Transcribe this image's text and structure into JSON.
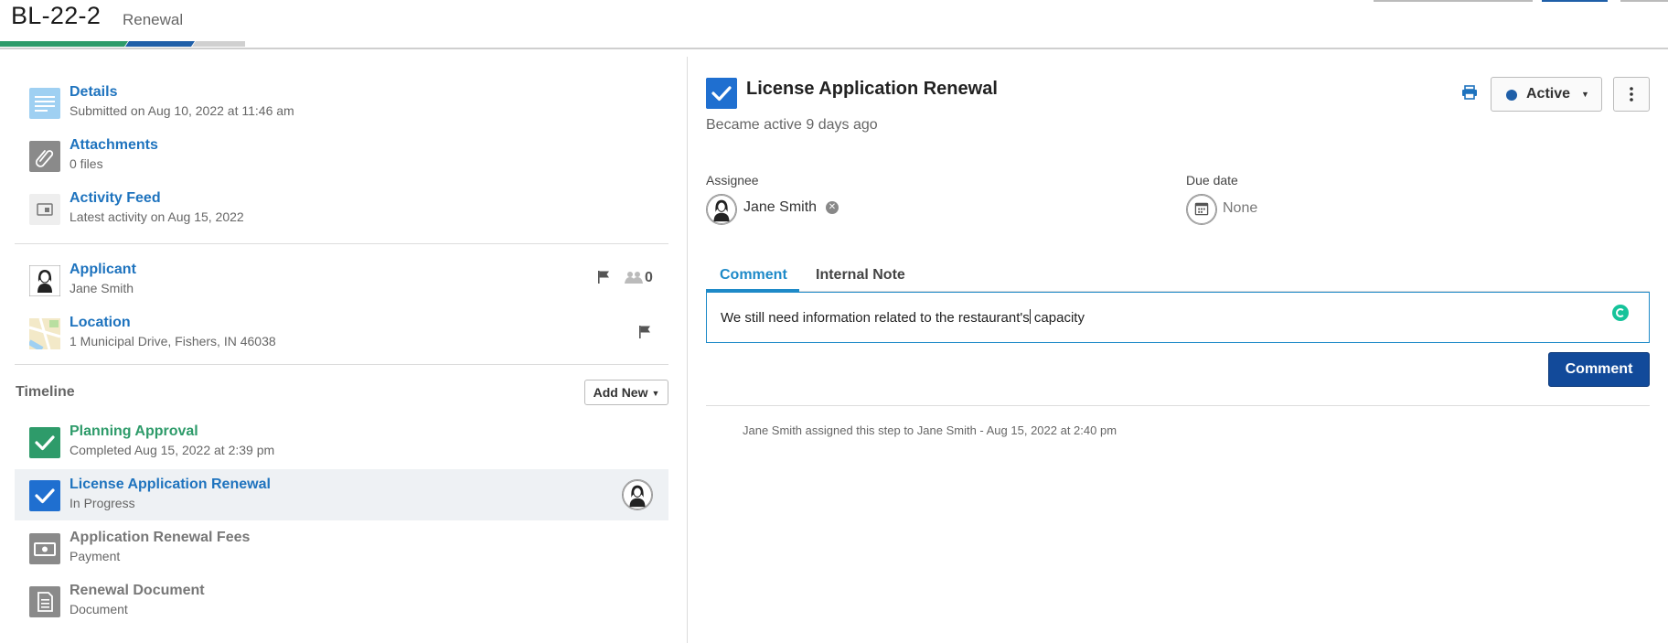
{
  "header": {
    "record_id": "BL-22-2",
    "record_type": "Renewal"
  },
  "summary_items": [
    {
      "title": "Details",
      "subtitle": "Submitted on Aug 10, 2022 at 11:46 am",
      "icon": "document-lines-icon"
    },
    {
      "title": "Attachments",
      "subtitle": "0 files",
      "icon": "paperclip-icon"
    },
    {
      "title": "Activity Feed",
      "subtitle": "Latest activity on Aug 15, 2022",
      "icon": "activity-feed-icon"
    }
  ],
  "contacts": {
    "applicant": {
      "title": "Applicant",
      "subtitle": "Jane Smith",
      "people_count": "0",
      "icon": "person-avatar-icon"
    },
    "location": {
      "title": "Location",
      "subtitle": "1 Municipal Drive, Fishers, IN 46038",
      "icon": "map-icon"
    }
  },
  "timeline": {
    "label": "Timeline",
    "add_new_label": "Add New",
    "steps": [
      {
        "title": "Planning Approval",
        "subtitle": "Completed Aug 15, 2022 at 2:39 pm",
        "state": "completed",
        "icon": "check-icon"
      },
      {
        "title": "License Application Renewal",
        "subtitle": "In Progress",
        "state": "in-progress",
        "icon": "check-icon"
      },
      {
        "title": "Application Renewal Fees",
        "subtitle": "Payment",
        "state": "pending",
        "icon": "payment-icon"
      },
      {
        "title": "Renewal Document",
        "subtitle": "Document",
        "state": "pending",
        "icon": "document-icon"
      }
    ]
  },
  "task": {
    "title": "License Application Renewal",
    "subtitle": "Became active 9 days ago",
    "status_label": "Active",
    "assignee_label": "Assignee",
    "assignee_name": "Jane Smith",
    "due_date_label": "Due date",
    "due_date_value": "None"
  },
  "comment": {
    "tabs": [
      "Comment",
      "Internal Note"
    ],
    "text_before_cursor": "We still need information related to the restaurant's",
    "text_after_cursor": " capacity",
    "submit_label": "Comment"
  },
  "activity": {
    "entries": [
      "Jane Smith assigned this step to Jane Smith - Aug 15, 2022 at 2:40 pm"
    ]
  },
  "colors": {
    "primary_blue": "#1e73be",
    "completed_green": "#2e9b6a",
    "active_tab": "#1e8ac8",
    "button_navy": "#124a9a"
  }
}
